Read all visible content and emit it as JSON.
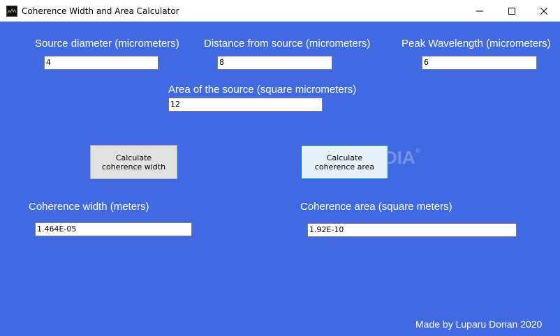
{
  "window": {
    "title": "Coherence Width and Area Calculator",
    "background_color": "#4169e1",
    "controls": {
      "minimize_icon": "minimize-icon",
      "maximize_icon": "maximize-icon",
      "close_icon": "close-icon"
    }
  },
  "inputs": {
    "source_diameter": {
      "label": "Source diameter (micrometers)",
      "value": "4"
    },
    "distance": {
      "label": "Distance from source (micrometers)",
      "value": "8"
    },
    "wavelength": {
      "label": "Peak Wavelength (micrometers)",
      "value": "6"
    },
    "area_source": {
      "label": "Area of the source (square micrometers)",
      "value": "12"
    }
  },
  "buttons": {
    "calc_width": "Calculate coherence width",
    "calc_area": "Calculate coherence area"
  },
  "outputs": {
    "coherence_width": {
      "label": "Coherence width (meters)",
      "value": "1.464E-05"
    },
    "coherence_area": {
      "label": "Coherence area (square meters)",
      "value": "1.92E-10"
    }
  },
  "watermark": {
    "text": "SOFTPEDIA",
    "mark": "®"
  },
  "footer": "Made by Luparu Dorian 2020"
}
